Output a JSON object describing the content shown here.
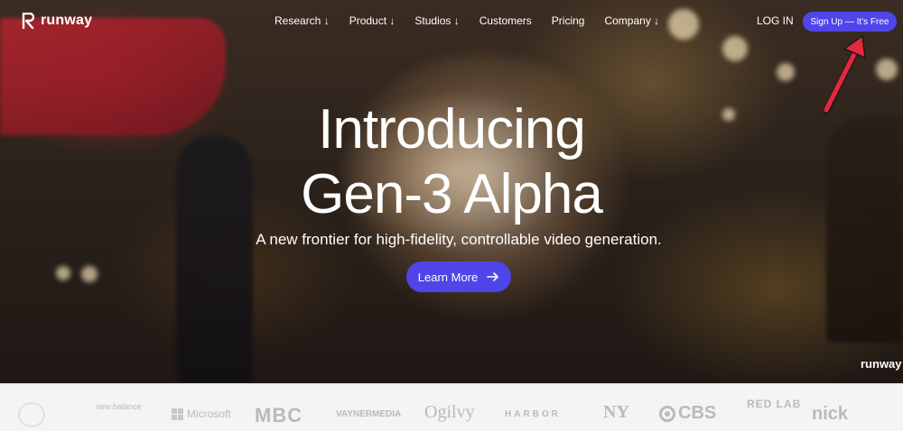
{
  "brand": {
    "logo_text": "runway",
    "logo_icon": "runway-r-icon"
  },
  "nav": {
    "links": [
      "Research ↓",
      "Product ↓",
      "Studios ↓",
      "Customers",
      "Pricing",
      "Company ↓"
    ],
    "login": "LOG IN",
    "signup": "Sign Up — It's Free"
  },
  "hero": {
    "headline_line1": "Introducing",
    "headline_line2": "Gen-3 Alpha",
    "subhead": "A new frontier for high-fidelity, controllable video generation.",
    "cta_label": "Learn More",
    "cta_icon": "arrow-right-icon",
    "watermark": "runway"
  },
  "logos": {
    "new_balance": "new balance",
    "microsoft": "Microsoft",
    "mbc": "MBC",
    "vaynermedia": "VAYNERMEDIA",
    "ogilvy": "Ogilvy",
    "harbor": "HARBOR",
    "yankees": "NY",
    "cbs": "CBS",
    "red_lab": "RED LAB",
    "nick": "nick"
  },
  "colors": {
    "accent": "#4f45e8",
    "annotation": "#e8283c",
    "logo_strip_bg": "#f4f4f5"
  }
}
